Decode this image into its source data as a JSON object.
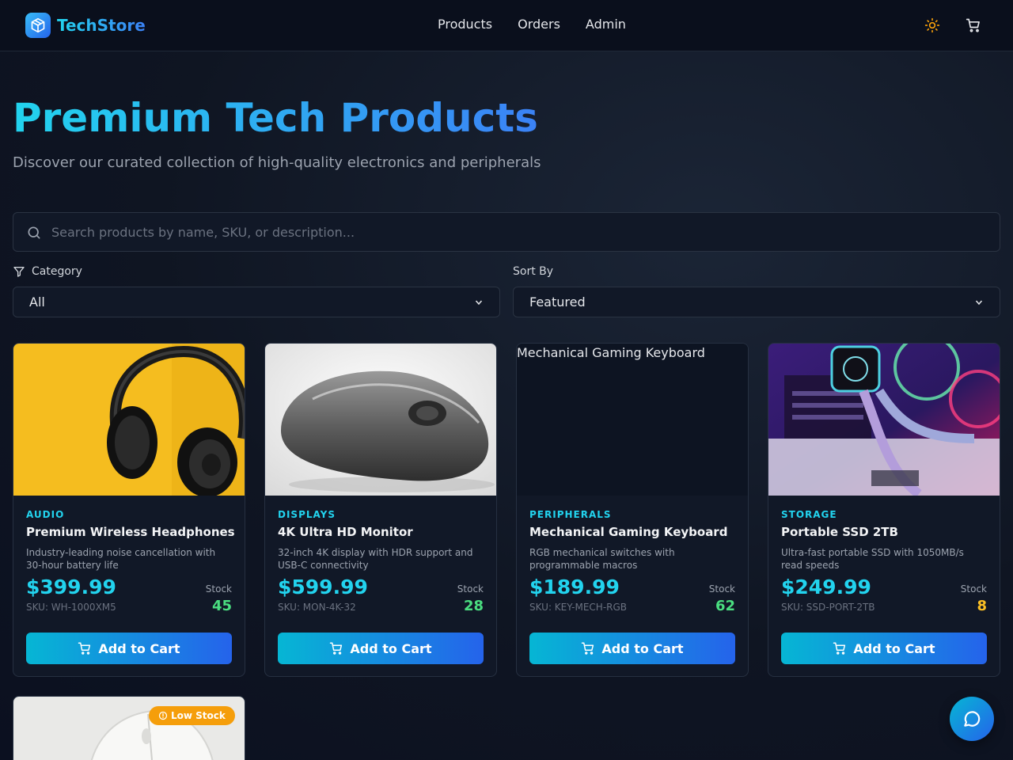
{
  "nav": {
    "brand": "TechStore",
    "links": [
      "Products",
      "Orders",
      "Admin"
    ],
    "icons": [
      "sun-icon",
      "cart-icon"
    ]
  },
  "hero": {
    "title": "Premium Tech Products",
    "subtitle": "Discover our curated collection of high-quality electronics and peripherals"
  },
  "search": {
    "placeholder": "Search products by name, SKU, or description...",
    "value": ""
  },
  "filters": {
    "category_label": "Category",
    "category_value": "All",
    "sort_label": "Sort By",
    "sort_value": "Featured"
  },
  "products": [
    {
      "category": "AUDIO",
      "name": "Premium Wireless Headphones",
      "description": "Industry-leading noise cancellation with 30-hour battery life",
      "price": "$399.99",
      "sku": "SKU: WH-1000XM5",
      "stock_label": "Stock",
      "stock": "45",
      "stock_color": "#4ade80",
      "button": "Add to Cart"
    },
    {
      "category": "DISPLAYS",
      "name": "4K Ultra HD Monitor",
      "description": "32-inch 4K display with HDR support and USB-C connectivity",
      "price": "$599.99",
      "sku": "SKU: MON-4K-32",
      "stock_label": "Stock",
      "stock": "28",
      "stock_color": "#4ade80",
      "button": "Add to Cart"
    },
    {
      "category": "PERIPHERALS",
      "name": "Mechanical Gaming Keyboard",
      "description": "RGB mechanical switches with programmable macros",
      "price": "$189.99",
      "sku": "SKU: KEY-MECH-RGB",
      "stock_label": "Stock",
      "stock": "62",
      "stock_color": "#4ade80",
      "button": "Add to Cart",
      "image_alt": "Mechanical Gaming Keyboard"
    },
    {
      "category": "STORAGE",
      "name": "Portable SSD 2TB",
      "description": "Ultra-fast portable SSD with 1050MB/s read speeds",
      "price": "$249.99",
      "sku": "SKU: SSD-PORT-2TB",
      "stock_label": "Stock",
      "stock": "8",
      "stock_color": "#fbbf24",
      "button": "Add to Cart"
    }
  ],
  "partial_card": {
    "badge": "Low Stock"
  },
  "colors": {
    "accent": "#22d3ee",
    "brand_blue": "#2563eb",
    "stock_ok": "#4ade80",
    "stock_low": "#fbbf24",
    "badge": "#f59e0b"
  }
}
